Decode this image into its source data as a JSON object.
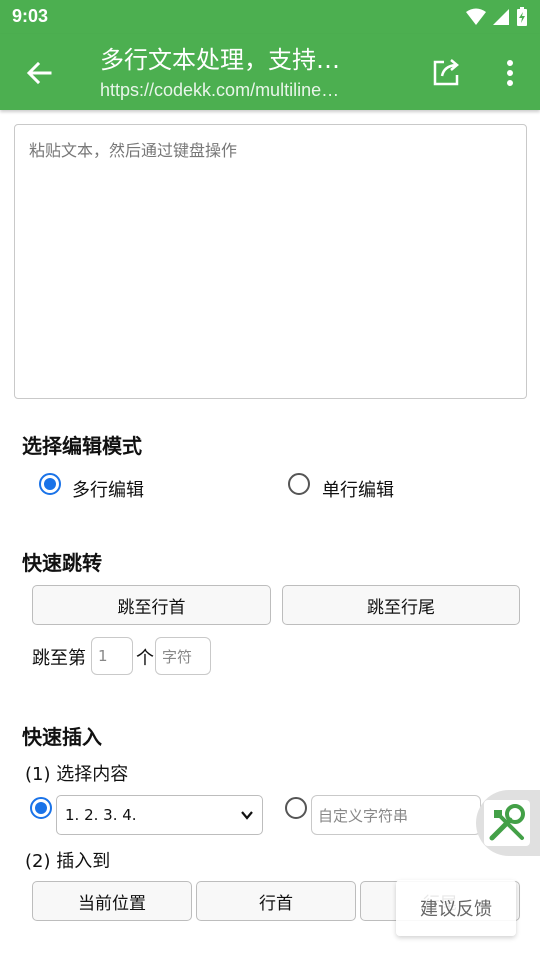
{
  "status": {
    "time": "9:03"
  },
  "appbar": {
    "title": "多行文本处理，支持…",
    "subtitle": "https://codekk.com/multiline…"
  },
  "editor": {
    "placeholder": "粘贴文本，然后通过键盘操作"
  },
  "edit_mode": {
    "title": "选择编辑模式",
    "options": [
      {
        "label": "多行编辑",
        "checked": true
      },
      {
        "label": "单行编辑",
        "checked": false
      }
    ]
  },
  "quick_jump": {
    "title": "快速跳转",
    "to_line_start": "跳至行首",
    "to_line_end": "跳至行尾",
    "jump_prefix": "跳至第",
    "jump_value": "1",
    "jump_unit": "个",
    "char_placeholder": "字符"
  },
  "quick_insert": {
    "title": "快速插入",
    "step1": "(1) 选择内容",
    "select_value": "1. 2. 3. 4.",
    "custom_placeholder": "自定义字符串",
    "step2": "(2) 插入到",
    "buttons": [
      "当前位置",
      "行首",
      "行尾"
    ]
  },
  "feedback": {
    "label": "建议反馈"
  },
  "colors": {
    "appbar": "#4caf50",
    "radio_accent": "#1a73e8"
  }
}
